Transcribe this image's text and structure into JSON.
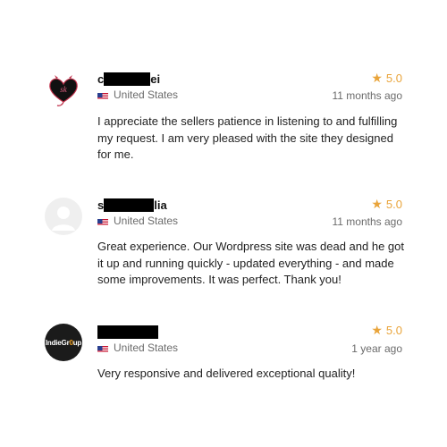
{
  "reviews": [
    {
      "name_prefix": "c",
      "name_suffix": "ei",
      "avatar_icon": "heart-logo-icon",
      "country": "United States",
      "flag_icon": "us-flag-icon",
      "rating": "5.0",
      "time": "11 months ago",
      "text": "I appreciate the sellers patience in listening to and fulfilling my request. I am very pleased with the site they designed for me."
    },
    {
      "name_prefix": "s",
      "name_suffix": "lia",
      "avatar_icon": "default-user-icon",
      "country": "United States",
      "flag_icon": "us-flag-icon",
      "rating": "5.0",
      "time": "11 months ago",
      "text": "Great experience. Our Wordpress site was dead and he got it up and running quickly - updated everything - and made some improvements. It was perfect. Thank you!"
    },
    {
      "name_prefix": "",
      "name_suffix": "",
      "avatar_icon": "indie-group-logo-icon",
      "avatar_logo_main": "IndieGr",
      "avatar_logo_accent": "0",
      "avatar_logo_tail": "up",
      "country": "United States",
      "flag_icon": "us-flag-icon",
      "rating": "5.0",
      "time": "1 year ago",
      "text": "Very responsive and delivered exceptional quality!"
    }
  ],
  "colors": {
    "star": "#e9a43a",
    "muted_text": "#6b6b6b",
    "redaction": "#000000"
  }
}
